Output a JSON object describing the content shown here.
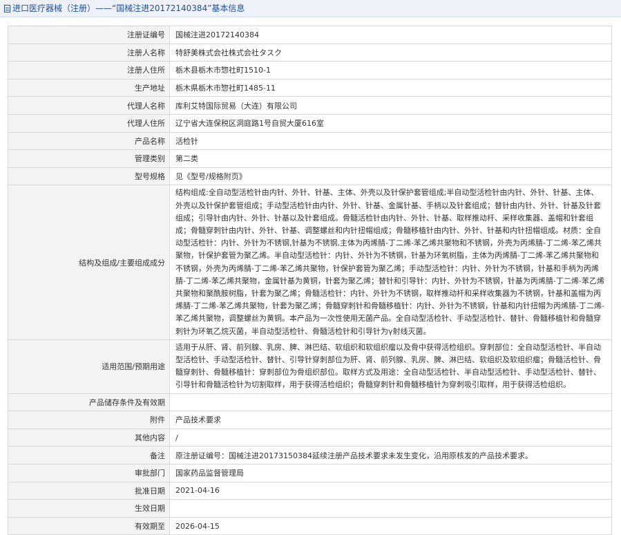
{
  "header": {
    "title": "进口医疗器械（注册）——“国械注进20172140384”基本信息"
  },
  "rows": [
    {
      "label": "注册证编号",
      "value": "国械注进20172140384"
    },
    {
      "label": "注册人名称",
      "value": "特舒美株式会社株式会社タスク"
    },
    {
      "label": "注册人住所",
      "value": "栃木县栃木市惣社町1510-1"
    },
    {
      "label": "生产地址",
      "value": "栃木県栃木市惣社町1485-11"
    },
    {
      "label": "代理人名称",
      "value": "库利艾特国际贸易（大连）有限公司"
    },
    {
      "label": "代理人住所",
      "value": "辽宁省大连保税区洞庭路1号自贸大厦616室"
    },
    {
      "label": "产品名称",
      "value": "活检针"
    },
    {
      "label": "管理类别",
      "value": "第二类"
    },
    {
      "label": "型号规格",
      "value": "见《型号/规格附页》"
    },
    {
      "label": "结构及组成/主要组成成分",
      "value": "结构组成:全自动型活检针由内针、外针、针基、主体、外壳以及针保护套管组成;半自动型活检针由内针、外针、针基、主体、外壳以及针保护套管组成；手动型活检针由内针、外针、针基、金属针基、手柄以及针套组成；替针由内针、外针、针基及针套组成；引导针由内针、外针、针基以及针套组成。骨髓活检针由内针、外针、针基、取样推动杆、采样收集器、盖帽和针套组成；骨髓穿刺针由内针、外针、针基、调整螺丝和内针扭帽组成；骨髓移植针由内针、外针、针基和内针扭帽组成。材质：全自动型活检针：内针、外针为不锈钢,针基为不锈钢,主体为丙烯腈-丁二烯-苯乙烯共聚物和不锈钢，外壳为丙烯腈-丁二烯-苯乙烯共聚物，针保护套管为聚乙烯。半自动型活检针：内针、外针为不锈钢，针基为环氧树脂，主体为丙烯腈-丁二烯-苯乙烯共聚物和不锈钢，外壳为丙烯腈-丁二烯-苯乙烯共聚物，针保护套管为聚乙烯；手动型活检针：内针、外针为不锈钢，针基和手柄为丙烯腈-丁二烯-苯乙烯共聚物，金属针基为黄铜，针套为聚乙烯；替针和引导针：内针、外针为不锈钢，针基为丙烯腈-丁二烯-苯乙烯共聚物和聚酰胺树脂，针套为聚乙烯；骨髓活检针：内针、外针为不锈钢，取样推动杆和采样收集器为不锈钢，针基和盖帽为丙烯腈-丁二烯-苯乙烯共聚物，针套为聚乙烯；骨髓穿刺针和骨髓移植针：内针、外针为不锈钢，针基和内针扭帽为丙烯腈-丁二烯-苯乙烯共聚物，调整螺丝为黄铜。本产品为一次性使用无菌产品。全自动型活检针、手动型活检针、替针、骨髓移植针和骨髓穿刺针为环氧乙烷灭菌，半自动型活检针、骨髓活检针和引导针为γ射线灭菌。"
    },
    {
      "label": "适用范围/预期用途",
      "value": "适用于从肝、肾、前列腺、乳房、脾、淋巴结、软组织和软组织瘤以及骨中获得活检组织。穿刺部位：全自动型活检针、半自动型活检针、手动型活检针、替针、引导针穿刺部位为肝、肾、前列腺、乳房、脾、淋巴结、软组织及软组织瘤；骨髓活检针、骨髓穿刺针、骨髓移植针：穿刺部位为骨组织部位。取样方式及用途：全自动型活检针、半自动型活检针、手动型活检针、替针、引导针和骨髓活检针为切割取样，用于获得活检组织；骨髓穿刺针和骨髓移植针为穿刺吸引取样，用于获得活检组织。"
    },
    {
      "label": "产品储存条件及有效期",
      "value": ""
    },
    {
      "label": "附件",
      "value": "产品技术要求"
    },
    {
      "label": "其他内容",
      "value": "/"
    },
    {
      "label": "备注",
      "value": "原注册证编号：国械注进20173150384延续注册产品技术要求未发生变化，沿用原核发的产品技术要求。"
    },
    {
      "label": "审批部门",
      "value": "国家药品监督管理局"
    },
    {
      "label": "批准日期",
      "value": "2021-04-16"
    },
    {
      "label": "生效日期",
      "value": ""
    },
    {
      "label": "有效期至",
      "value": "2026-04-15"
    }
  ]
}
